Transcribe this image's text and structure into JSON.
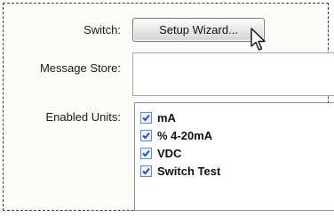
{
  "form": {
    "switch_label": "Switch:",
    "setup_wizard_label": "Setup Wizard...",
    "message_store_label": "Message Store:",
    "message_store_value": "",
    "enabled_units_label": "Enabled Units:"
  },
  "units": [
    {
      "label": "mA",
      "checked": true
    },
    {
      "label": "% 4-20mA",
      "checked": true
    },
    {
      "label": "VDC",
      "checked": true
    },
    {
      "label": "Switch Test",
      "checked": true
    }
  ],
  "colors": {
    "check": "#2b50a8",
    "checkbox_border": "#6f86b5"
  },
  "icons": {
    "cursor": "arrow-pointer-icon",
    "checkmark": "checkmark-icon"
  }
}
